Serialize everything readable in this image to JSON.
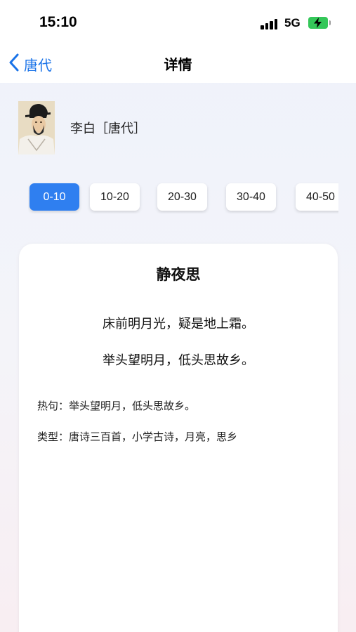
{
  "status_bar": {
    "time": "15:10",
    "network": "5G"
  },
  "nav": {
    "back_label": "唐代",
    "title": "详情"
  },
  "author": {
    "name": "李白［唐代］"
  },
  "range_tabs": [
    "0-10",
    "10-20",
    "20-30",
    "30-40",
    "40-50"
  ],
  "active_tab": "0-10",
  "poem": {
    "title": "静夜思",
    "lines": [
      "床前明月光，疑是地上霜。",
      "举头望明月，低头思故乡。"
    ],
    "hot_line": "热句：举头望明月，低头思故乡。",
    "category": "类型：唐诗三百首，小学古诗，月亮，思乡"
  },
  "colors": {
    "accent": "#2f7ff0",
    "back_link": "#1a73e8",
    "battery": "#34c759"
  },
  "icons": [
    "chevron-left-icon",
    "signal-icon",
    "battery-charging-icon",
    "author-portrait"
  ]
}
